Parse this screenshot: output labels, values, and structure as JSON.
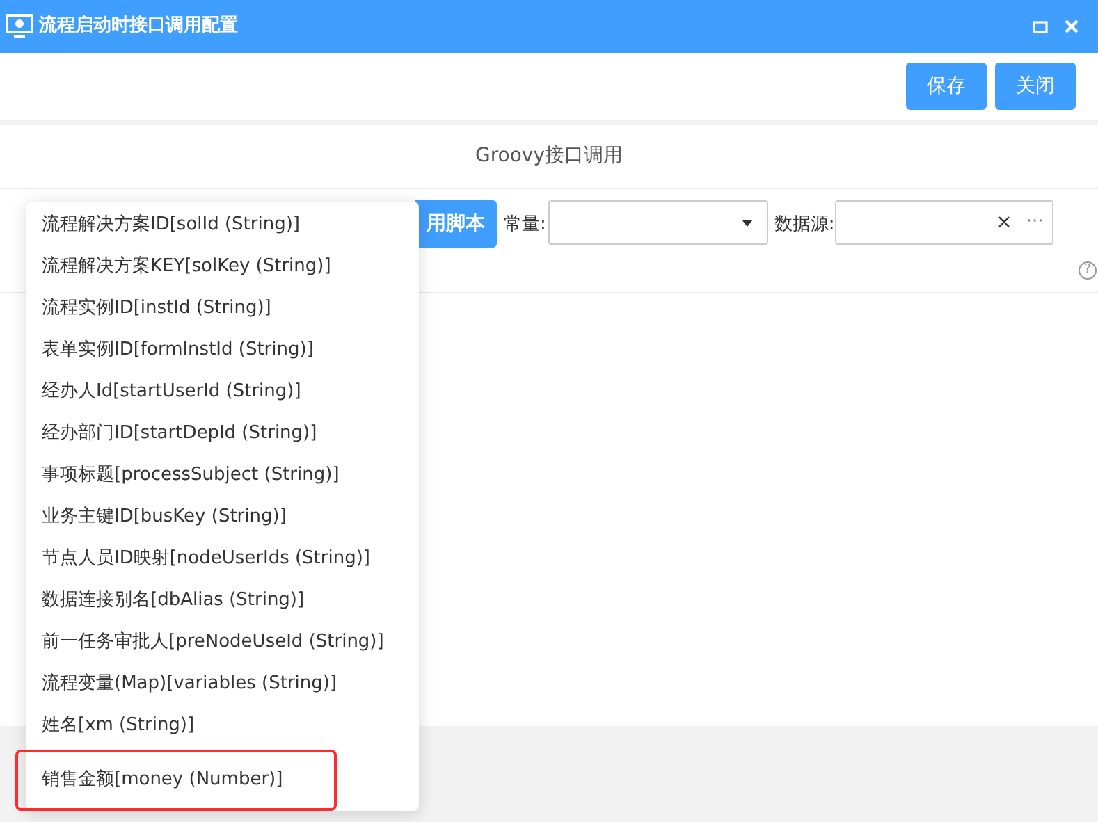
{
  "window": {
    "title": "流程启动时接口调用配置"
  },
  "toolbar": {
    "buttons": [
      "保存",
      "关闭"
    ]
  },
  "section": {
    "title": "Groovy接口调用"
  },
  "script_row": {
    "button": "用脚本",
    "constant_label": "常量:",
    "datasource_label": "数据源:",
    "clear": "×",
    "more": "···",
    "help": "?"
  },
  "dropdown": {
    "items": [
      {
        "label": "流程解决方案ID[solId (String)]",
        "annotated": false
      },
      {
        "label": "流程解决方案KEY[solKey (String)]",
        "annotated": false
      },
      {
        "label": "流程实例ID[instId (String)]",
        "annotated": false
      },
      {
        "label": "表单实例ID[formInstId (String)]",
        "annotated": false
      },
      {
        "label": "经办人Id[startUserId (String)]",
        "annotated": false
      },
      {
        "label": "经办部门ID[startDepId (String)]",
        "annotated": false
      },
      {
        "label": "事项标题[processSubject (String)]",
        "annotated": false
      },
      {
        "label": "业务主键ID[busKey (String)]",
        "annotated": false
      },
      {
        "label": "节点人员ID映射[nodeUserIds (String)]",
        "annotated": false
      },
      {
        "label": "数据连接别名[dbAlias (String)]",
        "annotated": false
      },
      {
        "label": "前一任务审批人[preNodeUseId (String)]",
        "annotated": false
      },
      {
        "label": "流程变量(Map)[variables (String)]",
        "annotated": false
      },
      {
        "label": "姓名[xm (String)]",
        "annotated": false
      },
      {
        "label": "销售金额[money (Number)]",
        "annotated": true
      }
    ]
  }
}
